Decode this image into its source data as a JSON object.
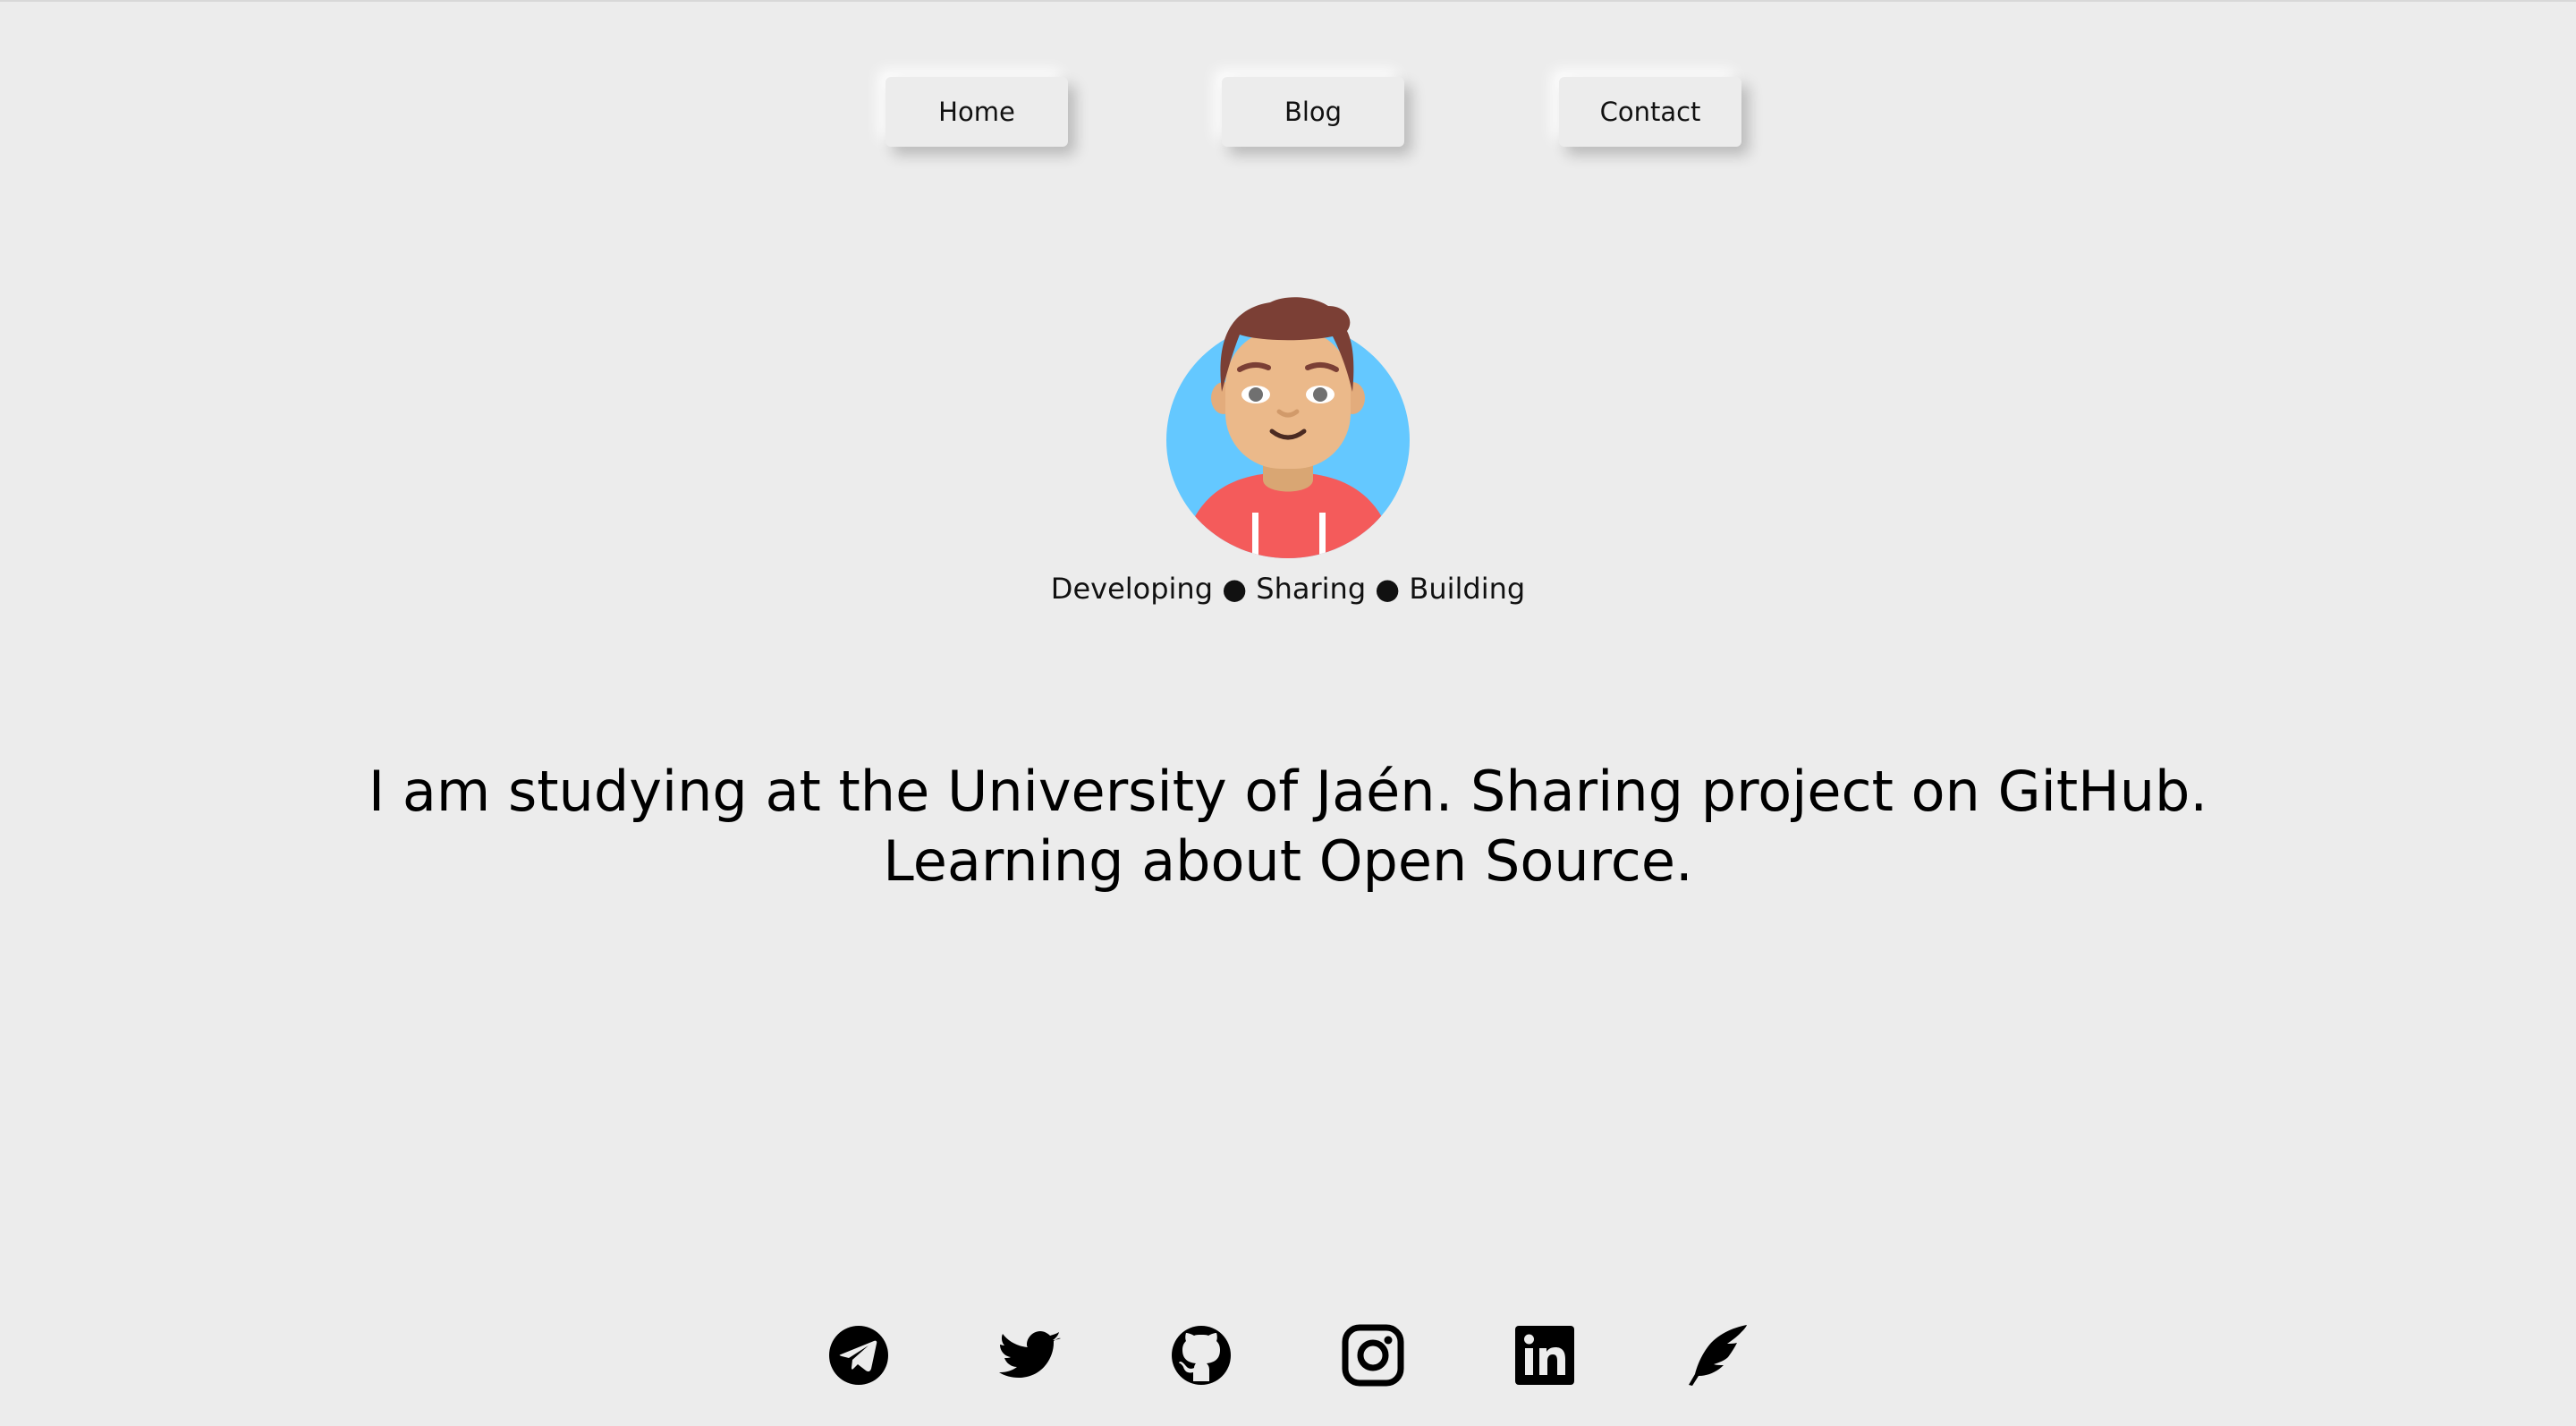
{
  "nav": {
    "items": [
      {
        "label": "Home"
      },
      {
        "label": "Blog"
      },
      {
        "label": "Contact"
      }
    ]
  },
  "profile": {
    "avatar_icon": "boy-avatar-icon",
    "tagline": "Developing ● Sharing ● Building",
    "bio": "I am studying at the University of Jaén. Sharing project on GitHub. Learning about Open Source."
  },
  "social": {
    "icons": [
      "telegram-icon",
      "twitter-icon",
      "github-icon",
      "instagram-icon",
      "linkedin-icon",
      "quill-icon"
    ]
  },
  "colors": {
    "background": "#ececec",
    "avatar_bg": "#64c8ff",
    "hair": "#7b3f35",
    "skin": "#ebb98a",
    "shirt": "#f45b5b"
  }
}
